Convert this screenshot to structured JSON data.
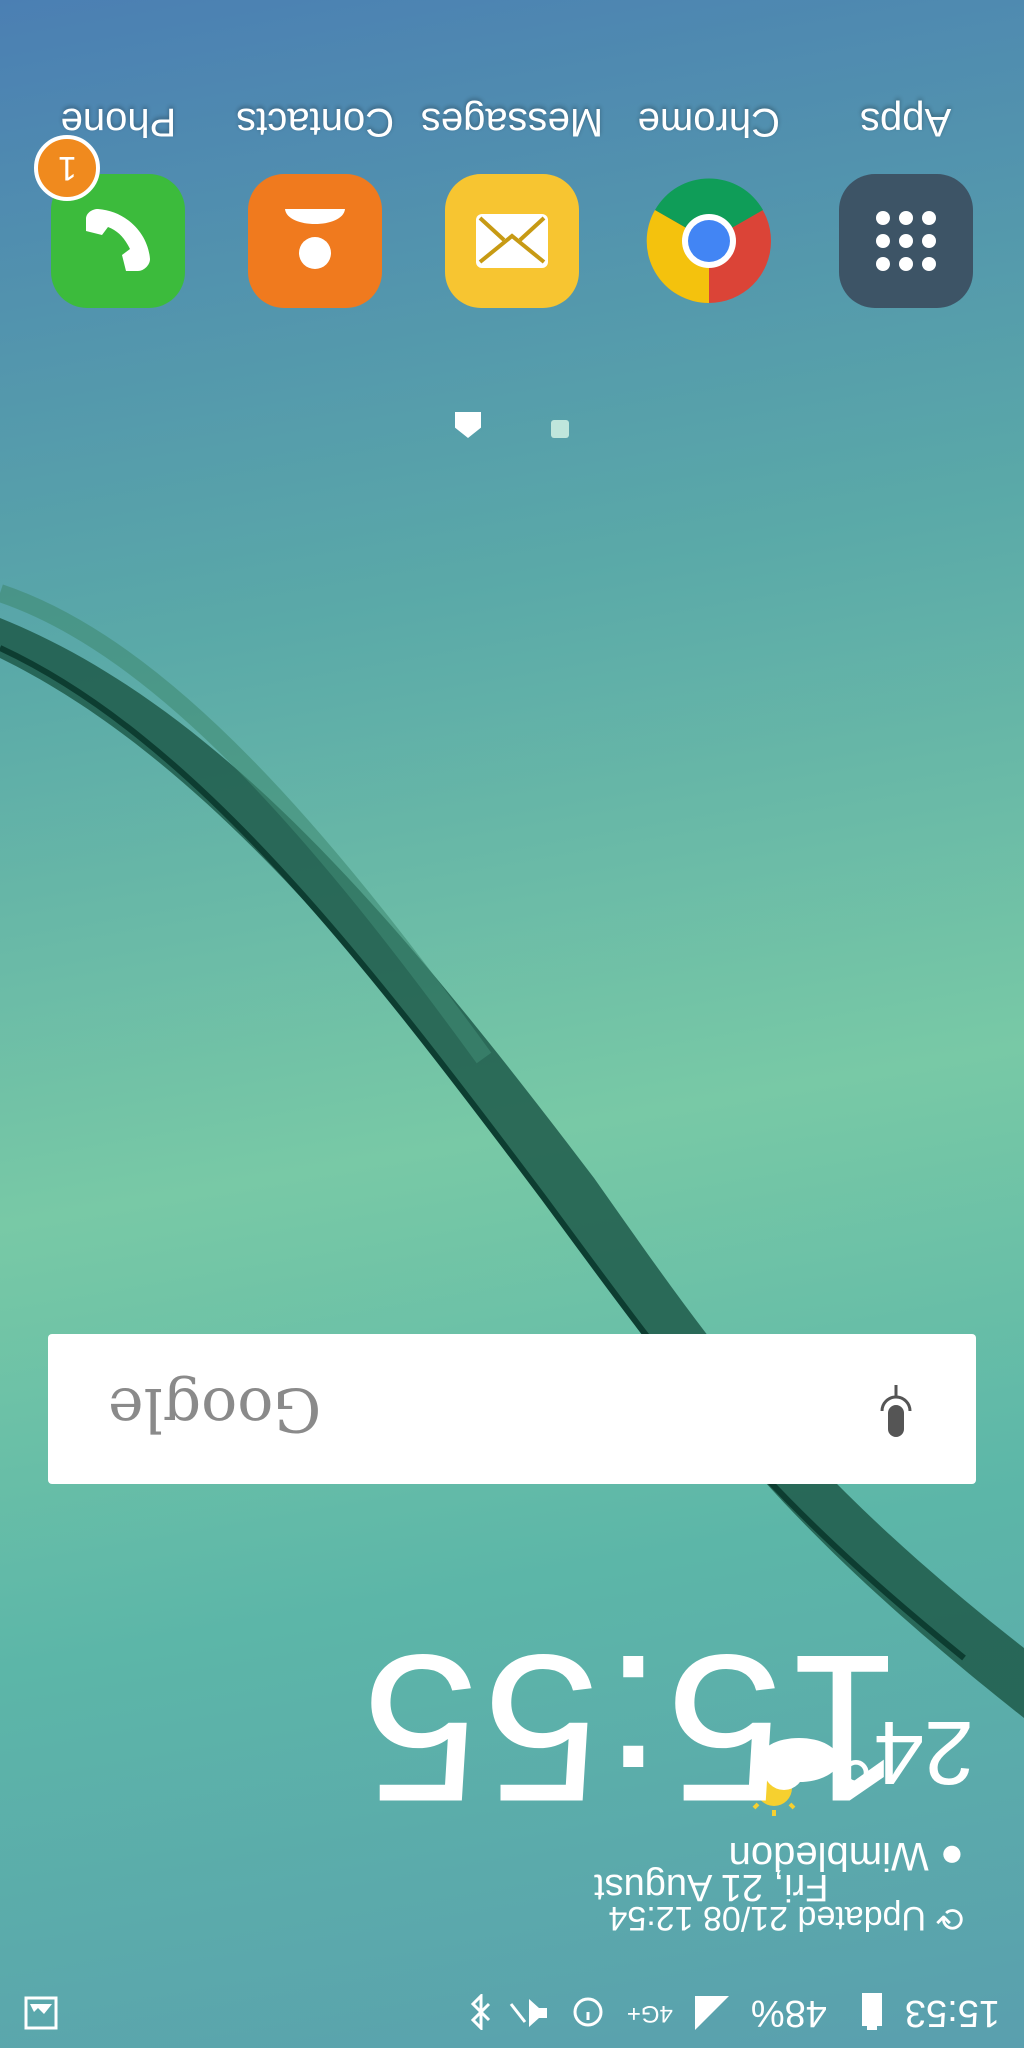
{
  "status_bar": {
    "time": "15:53",
    "battery": "48%",
    "network": "4G+"
  },
  "clock_widget": {
    "time": "15:55",
    "date": "Fri, 21 August",
    "temperature": "24°",
    "location": "Wimbledon",
    "updated": "Updated 21/08 12:54"
  },
  "search": {
    "logo_text": "Google"
  },
  "dock": {
    "apps": [
      {
        "label": "Phone",
        "badge": "1"
      },
      {
        "label": "Contacts"
      },
      {
        "label": "Messages"
      },
      {
        "label": "Chrome"
      },
      {
        "label": "Apps"
      }
    ]
  },
  "colors": {
    "phone": "#3cbb3c",
    "contacts": "#f07a1e",
    "messages": "#f7c531",
    "apps": "#3d5466",
    "badge": "#f08a1e"
  }
}
